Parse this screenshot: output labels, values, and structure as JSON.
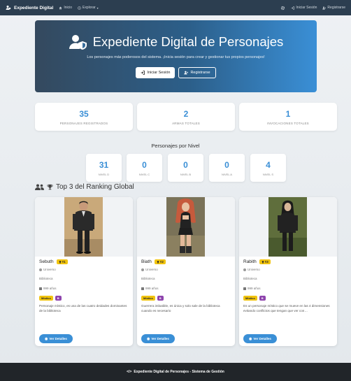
{
  "navbar": {
    "brand": "Expediente Digital",
    "links": [
      "Inicio",
      "Explorar"
    ],
    "login": "Iniciar Sesión",
    "register": "Registrarse"
  },
  "hero": {
    "title": "Expediente Digital de Personajes",
    "subtitle": "Los personajes más poderosos del sistema. ¡Inicia sesión para crear y gestionar tus propios personajes!",
    "login_button": "Iniciar Sesión",
    "register_button": "Registrarse"
  },
  "stats": [
    {
      "value": "35",
      "label": "PERSONAJES REGISTRADOS"
    },
    {
      "value": "2",
      "label": "ARMAS TOTALES"
    },
    {
      "value": "1",
      "label": "INVOCACIONES TOTALES"
    }
  ],
  "levels_title": "Personajes por Nivel",
  "levels": [
    {
      "value": "31",
      "label": "NIVEL D"
    },
    {
      "value": "0",
      "label": "NIVEL C"
    },
    {
      "value": "0",
      "label": "NIVEL B"
    },
    {
      "value": "0",
      "label": "NIVEL A"
    },
    {
      "value": "4",
      "label": "NIVEL S"
    }
  ],
  "ranking_title": "Top 3 del Ranking Global",
  "cards": [
    {
      "name": "Sebuth",
      "rank": "#1",
      "universe": "Universo",
      "place": "Biblioteca",
      "age": "999 años",
      "tag1": "Místico",
      "tag2": "B",
      "description": "Personaje místico, es una de las cuatro deidades dominantes de la biblioteca",
      "button": "Ver Detalles"
    },
    {
      "name": "Biath",
      "rank": "#2",
      "universe": "Universo",
      "place": "Biblioteca",
      "age": "999 años",
      "tag1": "Místico",
      "tag2": "B",
      "description": "Guerrera imbatible, es única y solo sale de la biblioteca cuando es necesario",
      "button": "Ver Detalles"
    },
    {
      "name": "Rabith",
      "rank": "#3",
      "universe": "Universo",
      "place": "Biblioteca",
      "age": "999 años",
      "tag1": "Místico",
      "tag2": "B",
      "description": "Es un personaje místico que se mueve en las 4 dimensiones evitando conflictos que tengan que ver con…",
      "button": "Ver Detalles"
    }
  ],
  "footer": "Expediente Digital de Personajes - Sistema de Gestión"
}
